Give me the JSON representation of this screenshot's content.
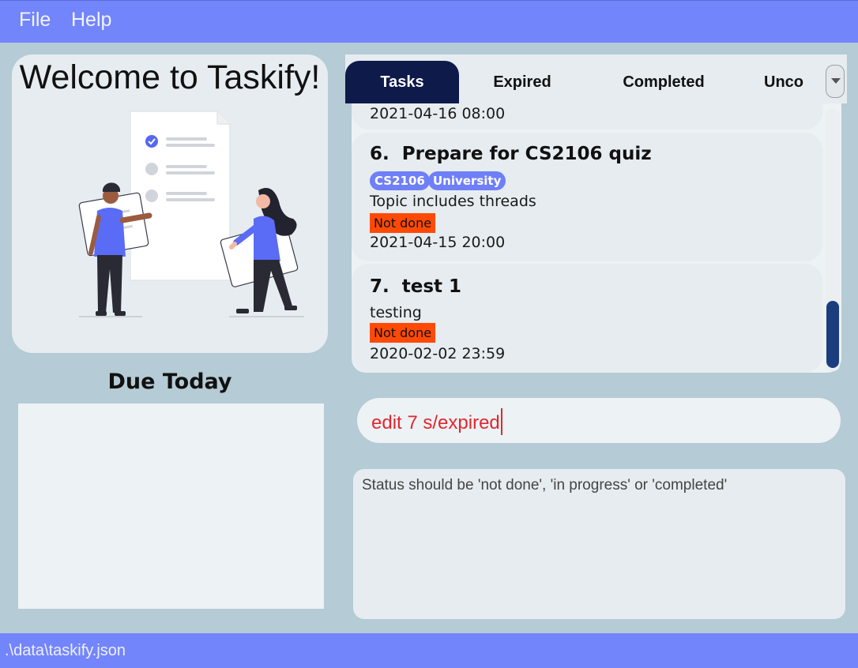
{
  "menu": {
    "file": "File",
    "help": "Help"
  },
  "welcome": {
    "title": "Welcome to Taskify!"
  },
  "due_today": {
    "title": "Due Today"
  },
  "tabs": [
    {
      "label": "Tasks",
      "active": true
    },
    {
      "label": "Expired",
      "active": false
    },
    {
      "label": "Completed",
      "active": false
    },
    {
      "label": "Unco",
      "active": false
    }
  ],
  "tasks": {
    "partial_date": "2021-04-16 08:00",
    "items": [
      {
        "index": "6.",
        "title": "Prepare for CS2106 quiz",
        "tags": [
          "CS2106",
          "University"
        ],
        "description": "Topic includes threads",
        "status": "Not done",
        "deadline": "2021-04-15 20:00"
      },
      {
        "index": "7.",
        "title": "test 1",
        "tags": [],
        "description": "testing",
        "status": "Not done",
        "deadline": "2020-02-02 23:59"
      }
    ]
  },
  "command": {
    "value": "edit 7 s/expired"
  },
  "result": {
    "message": "Status should be 'not done', 'in progress' or 'completed'"
  },
  "status_bar": {
    "path": ".\\data\\taskify.json"
  },
  "colors": {
    "menu_bar": "#7385fb",
    "background": "#b5cbd5",
    "active_tab": "#0e1a4a",
    "tag": "#6f7ff7",
    "status_not_done": "#ff4a06",
    "command_text": "#e0282e",
    "scroll_thumb": "#1c3d7d"
  }
}
